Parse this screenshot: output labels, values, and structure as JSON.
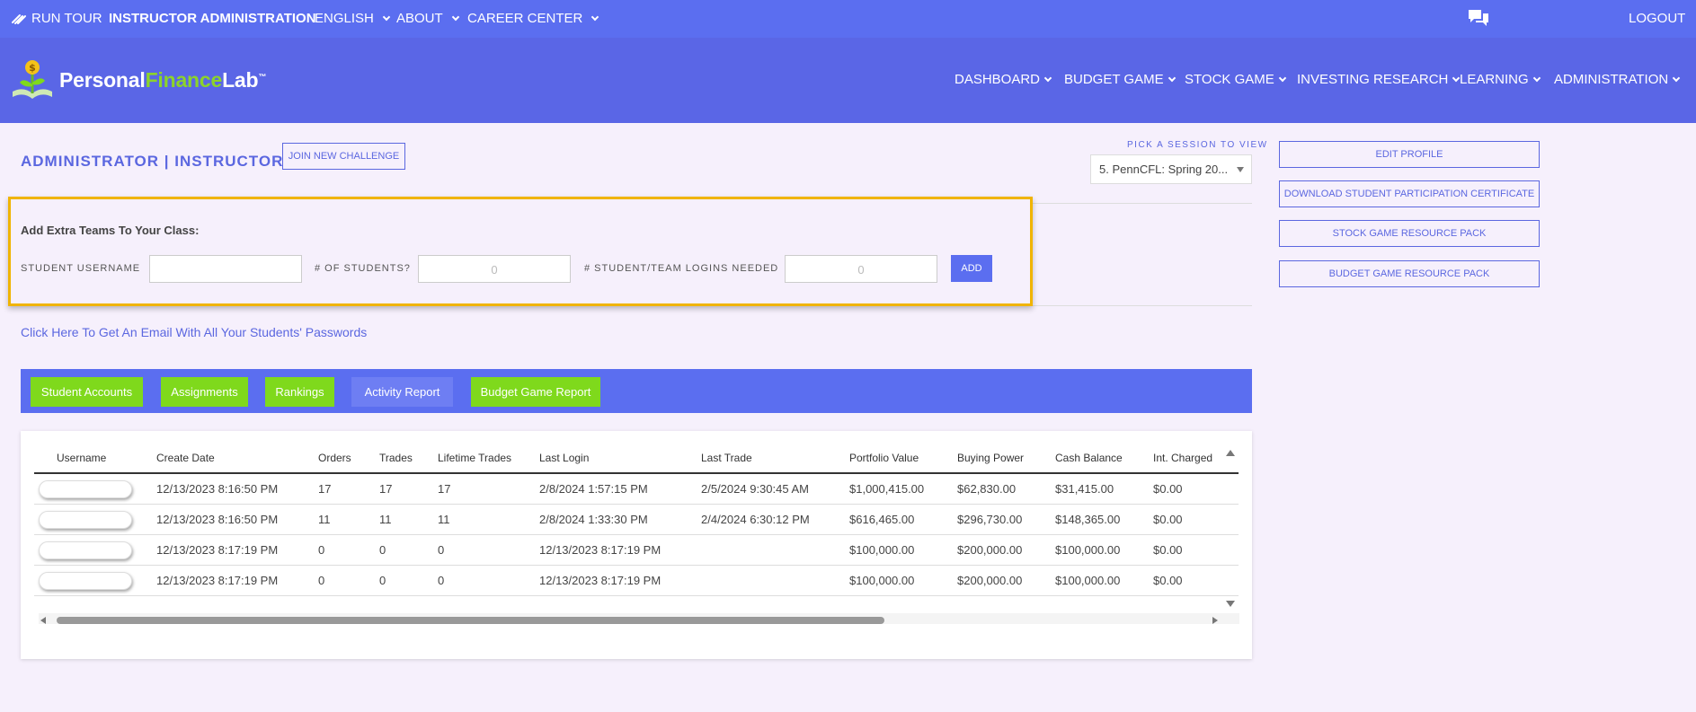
{
  "topbar": {
    "run_tour": "RUN TOUR",
    "instructor_admin": "INSTRUCTOR ADMINISTRATION",
    "english": "ENGLISH",
    "about": "ABOUT",
    "career_center": "CAREER CENTER",
    "logout": "LOGOUT",
    "chat_icon": "chat-bubbles-icon"
  },
  "logo": {
    "part1": "Personal",
    "part2": "Finance",
    "part3": "Lab",
    "tm": "™"
  },
  "nav": {
    "dashboard": "DASHBOARD",
    "budget_game": "BUDGET GAME",
    "stock_game": "STOCK GAME",
    "investing_research": "INVESTING RESEARCH",
    "learning": "LEARNING",
    "administration": "ADMINISTRATION"
  },
  "page": {
    "title": "ADMINISTRATOR | INSTRUCTOR",
    "join_challenge": "JOIN NEW CHALLENGE",
    "session_label": "PICK A SESSION TO VIEW",
    "session_value": "5. PennCFL: Spring 20...",
    "email_link": "Click Here To Get An Email With All Your Students' Passwords"
  },
  "side_buttons": {
    "edit_profile": "EDIT PROFILE",
    "certificate": "DOWNLOAD STUDENT PARTICIPATION CERTIFICATE",
    "stock_pack": "STOCK GAME RESOURCE PACK",
    "budget_pack": "BUDGET GAME RESOURCE PACK"
  },
  "add_teams": {
    "title": "Add Extra Teams To Your Class:",
    "username_label": "STUDENT USERNAME",
    "username_value": "",
    "students_label": "# OF STUDENTS?",
    "students_placeholder": "0",
    "logins_label": "# STUDENT/TEAM LOGINS NEEDED",
    "logins_placeholder": "0",
    "add_button": "ADD"
  },
  "tabs": {
    "student_accounts": "Student Accounts",
    "assignments": "Assignments",
    "rankings": "Rankings",
    "activity_report": "Activity Report",
    "budget_report": "Budget Game Report"
  },
  "table": {
    "headers": {
      "username": "Username",
      "create_date": "Create Date",
      "orders": "Orders",
      "trades": "Trades",
      "lifetime_trades": "Lifetime Trades",
      "last_login": "Last Login",
      "last_trade": "Last Trade",
      "portfolio_value": "Portfolio Value",
      "buying_power": "Buying Power",
      "cash_balance": "Cash Balance",
      "int_charged": "Int. Charged"
    },
    "rows": [
      {
        "create_date": "12/13/2023 8:16:50 PM",
        "orders": "17",
        "trades": "17",
        "lifetime": "17",
        "last_login": "2/8/2024 1:57:15 PM",
        "last_trade": "2/5/2024 9:30:45 AM",
        "portfolio": "$1,000,415.00",
        "buying": "$62,830.00",
        "cash": "$31,415.00",
        "interest": "$0.00"
      },
      {
        "create_date": "12/13/2023 8:16:50 PM",
        "orders": "11",
        "trades": "11",
        "lifetime": "11",
        "last_login": "2/8/2024 1:33:30 PM",
        "last_trade": "2/4/2024 6:30:12 PM",
        "portfolio": "$616,465.00",
        "buying": "$296,730.00",
        "cash": "$148,365.00",
        "interest": "$0.00"
      },
      {
        "create_date": "12/13/2023 8:17:19 PM",
        "orders": "0",
        "trades": "0",
        "lifetime": "0",
        "last_login": "12/13/2023 8:17:19 PM",
        "last_trade": "",
        "portfolio": "$100,000.00",
        "buying": "$200,000.00",
        "cash": "$100,000.00",
        "interest": "$0.00"
      },
      {
        "create_date": "12/13/2023 8:17:19 PM",
        "orders": "0",
        "trades": "0",
        "lifetime": "0",
        "last_login": "12/13/2023 8:17:19 PM",
        "last_trade": "",
        "portfolio": "$100,000.00",
        "buying": "$200,000.00",
        "cash": "$100,000.00",
        "interest": "$0.00"
      }
    ]
  },
  "colors": {
    "primary": "#5b6ef0",
    "header": "#5a66e6",
    "accent_green": "#7fd91c",
    "highlight_border": "#f0b400",
    "background": "#f6f0fc"
  }
}
